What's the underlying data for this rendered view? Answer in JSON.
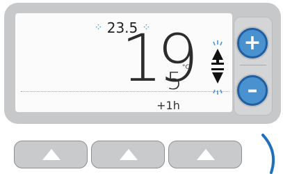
{
  "display": {
    "setpoint": "23.5",
    "temperature_main": "19",
    "temperature_decimal": "5",
    "unit": "°C",
    "offset": "+1h"
  },
  "controls": {
    "plus_symbol": "+",
    "minus_symbol": "–"
  },
  "colors": {
    "accent": "#4a91cf",
    "accent_dark": "#1f5fa4",
    "bezel": "#c7c8ca"
  },
  "icons": [
    "rays-icon",
    "up-down-arrow-icon",
    "plus-icon",
    "minus-icon",
    "triangle-up-icon"
  ]
}
